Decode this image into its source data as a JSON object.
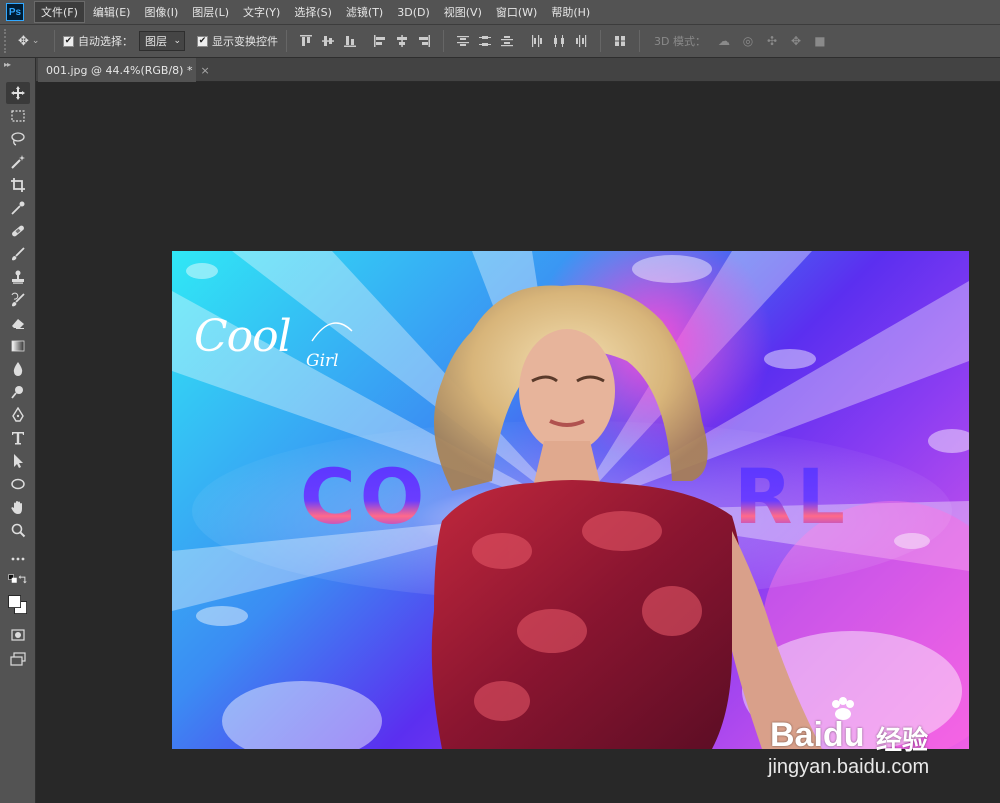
{
  "app": {
    "logo_text": "Ps"
  },
  "menu": {
    "items": [
      {
        "label": "文件(F)",
        "active": true
      },
      {
        "label": "编辑(E)"
      },
      {
        "label": "图像(I)"
      },
      {
        "label": "图层(L)"
      },
      {
        "label": "文字(Y)"
      },
      {
        "label": "选择(S)"
      },
      {
        "label": "滤镜(T)"
      },
      {
        "label": "3D(D)"
      },
      {
        "label": "视图(V)"
      },
      {
        "label": "窗口(W)"
      },
      {
        "label": "帮助(H)"
      }
    ]
  },
  "options": {
    "auto_select_label": "自动选择：",
    "auto_select_checked": true,
    "auto_select_target": "图层",
    "show_transform_label": "显示变换控件",
    "show_transform_checked": true,
    "mode_3d_label": "3D 模式："
  },
  "document": {
    "tab_title": "001.jpg @ 44.4%(RGB/8) *",
    "close_glyph": "×"
  },
  "image_content": {
    "script_title": "Cool",
    "script_subtitle": "Girl",
    "banner_left": "CO",
    "banner_right": "RL"
  },
  "watermark": {
    "brand": "Bai",
    "brand_paw": "du",
    "brand_cn": "经验",
    "url": "jingyan.baidu.com"
  },
  "colors": {
    "ui_panel": "#535353",
    "canvas_bg": "#282828",
    "ps_blue": "#31a8ff"
  }
}
